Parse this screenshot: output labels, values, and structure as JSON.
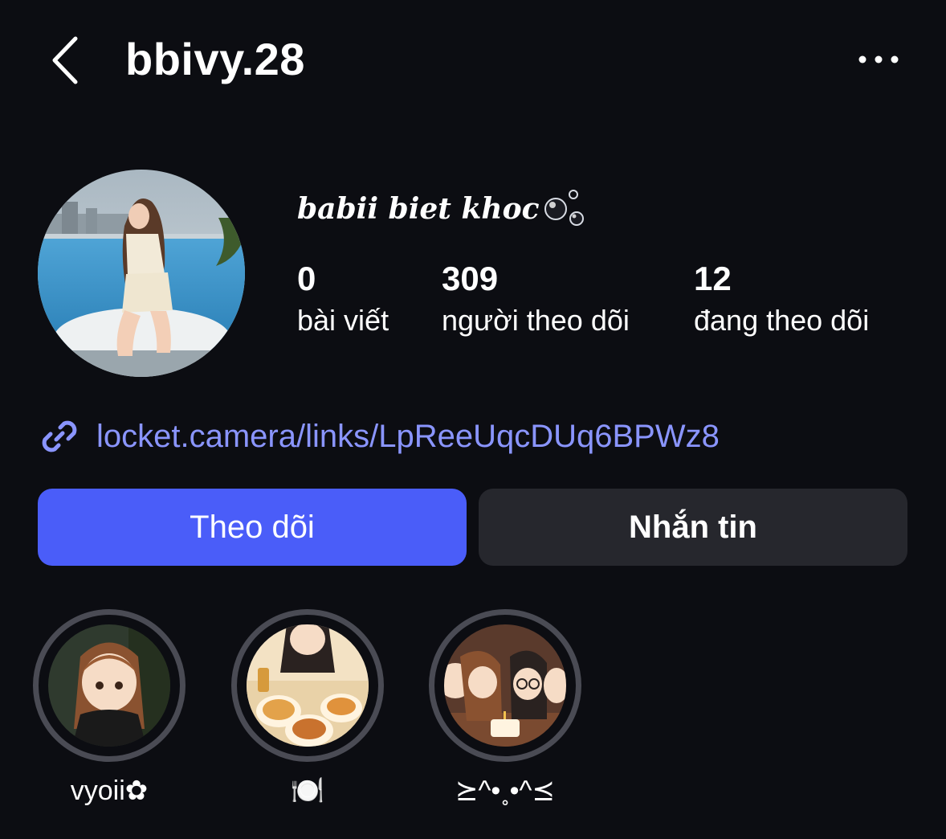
{
  "header": {
    "username": "bbivy.28"
  },
  "profile": {
    "display_name": "babii biet khoc",
    "stats": [
      {
        "value": "0",
        "label": "bài viết"
      },
      {
        "value": "309",
        "label": "người theo dõi"
      },
      {
        "value": "12",
        "label": "đang theo dõi"
      }
    ],
    "link": "locket.camera/links/LpReeUqcDUq6BPWz8"
  },
  "actions": {
    "follow_label": "Theo dõi",
    "message_label": "Nhắn tin"
  },
  "highlights": [
    {
      "label": "vyoii✿"
    },
    {
      "label": "🍽️"
    },
    {
      "label": "⪰^•˳•^⪯"
    }
  ],
  "colors": {
    "background": "#0c0d12",
    "accent": "#4a5df9",
    "link": "#8a95ff",
    "secondary_button": "#26272d",
    "highlight_ring": "#4a4b54"
  }
}
